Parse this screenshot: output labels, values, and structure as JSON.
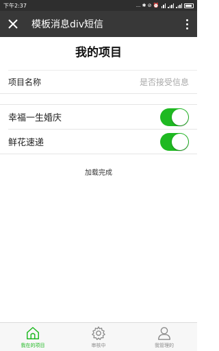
{
  "status_bar": {
    "time": "下午2:37",
    "icons": [
      "dots-icon",
      "bluetooth-icon",
      "dnd-icon",
      "alarm-icon",
      "wifi-icon",
      "signal-icon",
      "signal-icon",
      "battery-icon"
    ],
    "icon_text": "... ✱ ⊘ ⏰"
  },
  "title_bar": {
    "title": "模板消息div短信",
    "close_icon": "close-icon",
    "more_icon": "more-vertical-icon"
  },
  "page": {
    "heading": "我的项目",
    "header": {
      "name_label": "项目名称",
      "receive_label": "是否接受信息"
    },
    "items": [
      {
        "label": "幸福一生婚庆",
        "enabled": true
      },
      {
        "label": "鲜花速递",
        "enabled": true
      }
    ],
    "load_status": "加载完成"
  },
  "tab_bar": {
    "tabs": [
      {
        "label": "我在的项目",
        "icon": "home-icon",
        "active": true
      },
      {
        "label": "审核中",
        "icon": "gear-icon",
        "active": false
      },
      {
        "label": "我管理的",
        "icon": "person-icon",
        "active": false
      }
    ]
  },
  "colors": {
    "accent": "#1fb922",
    "title_bar": "#383838",
    "status_bar": "#2e2e2e"
  }
}
